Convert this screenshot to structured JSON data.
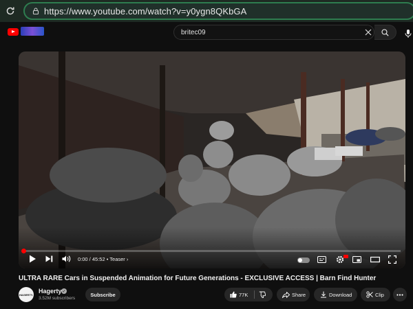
{
  "browser": {
    "url": "https://www.youtube.com/watch?v=y0ygn8QKbGA"
  },
  "header": {
    "search_value": "britec09"
  },
  "player": {
    "time": "0:00 / 45:52",
    "chapter": "Teaser",
    "progress_fraction": 0.0
  },
  "video": {
    "title": "ULTRA RARE Cars in Suspended Animation for Future Generations - EXCLUSIVE ACCESS | Barn Find Hunter"
  },
  "channel": {
    "name": "Hagerty",
    "avatar_text": "HAGERTY.",
    "subscribers": "3.52M subscribers",
    "subscribe_label": "Subscribe"
  },
  "actions": {
    "likes": "77K",
    "share_label": "Share",
    "download_label": "Download",
    "clip_label": "Clip"
  },
  "colors": {
    "accent": "#ff0000",
    "browser_bar": "#1e2a23",
    "url_border": "#2e7d4f"
  },
  "icons": [
    "reload-icon",
    "lock-icon",
    "youtube-logo",
    "search-icon",
    "close-icon",
    "mic-icon",
    "play-icon",
    "next-icon",
    "volume-icon",
    "autoplay-toggle",
    "subtitles-icon",
    "settings-icon",
    "miniplayer-icon",
    "theater-icon",
    "fullscreen-icon",
    "like-icon",
    "dislike-icon",
    "share-icon",
    "download-icon",
    "clip-icon",
    "more-icon",
    "verified-icon"
  ]
}
